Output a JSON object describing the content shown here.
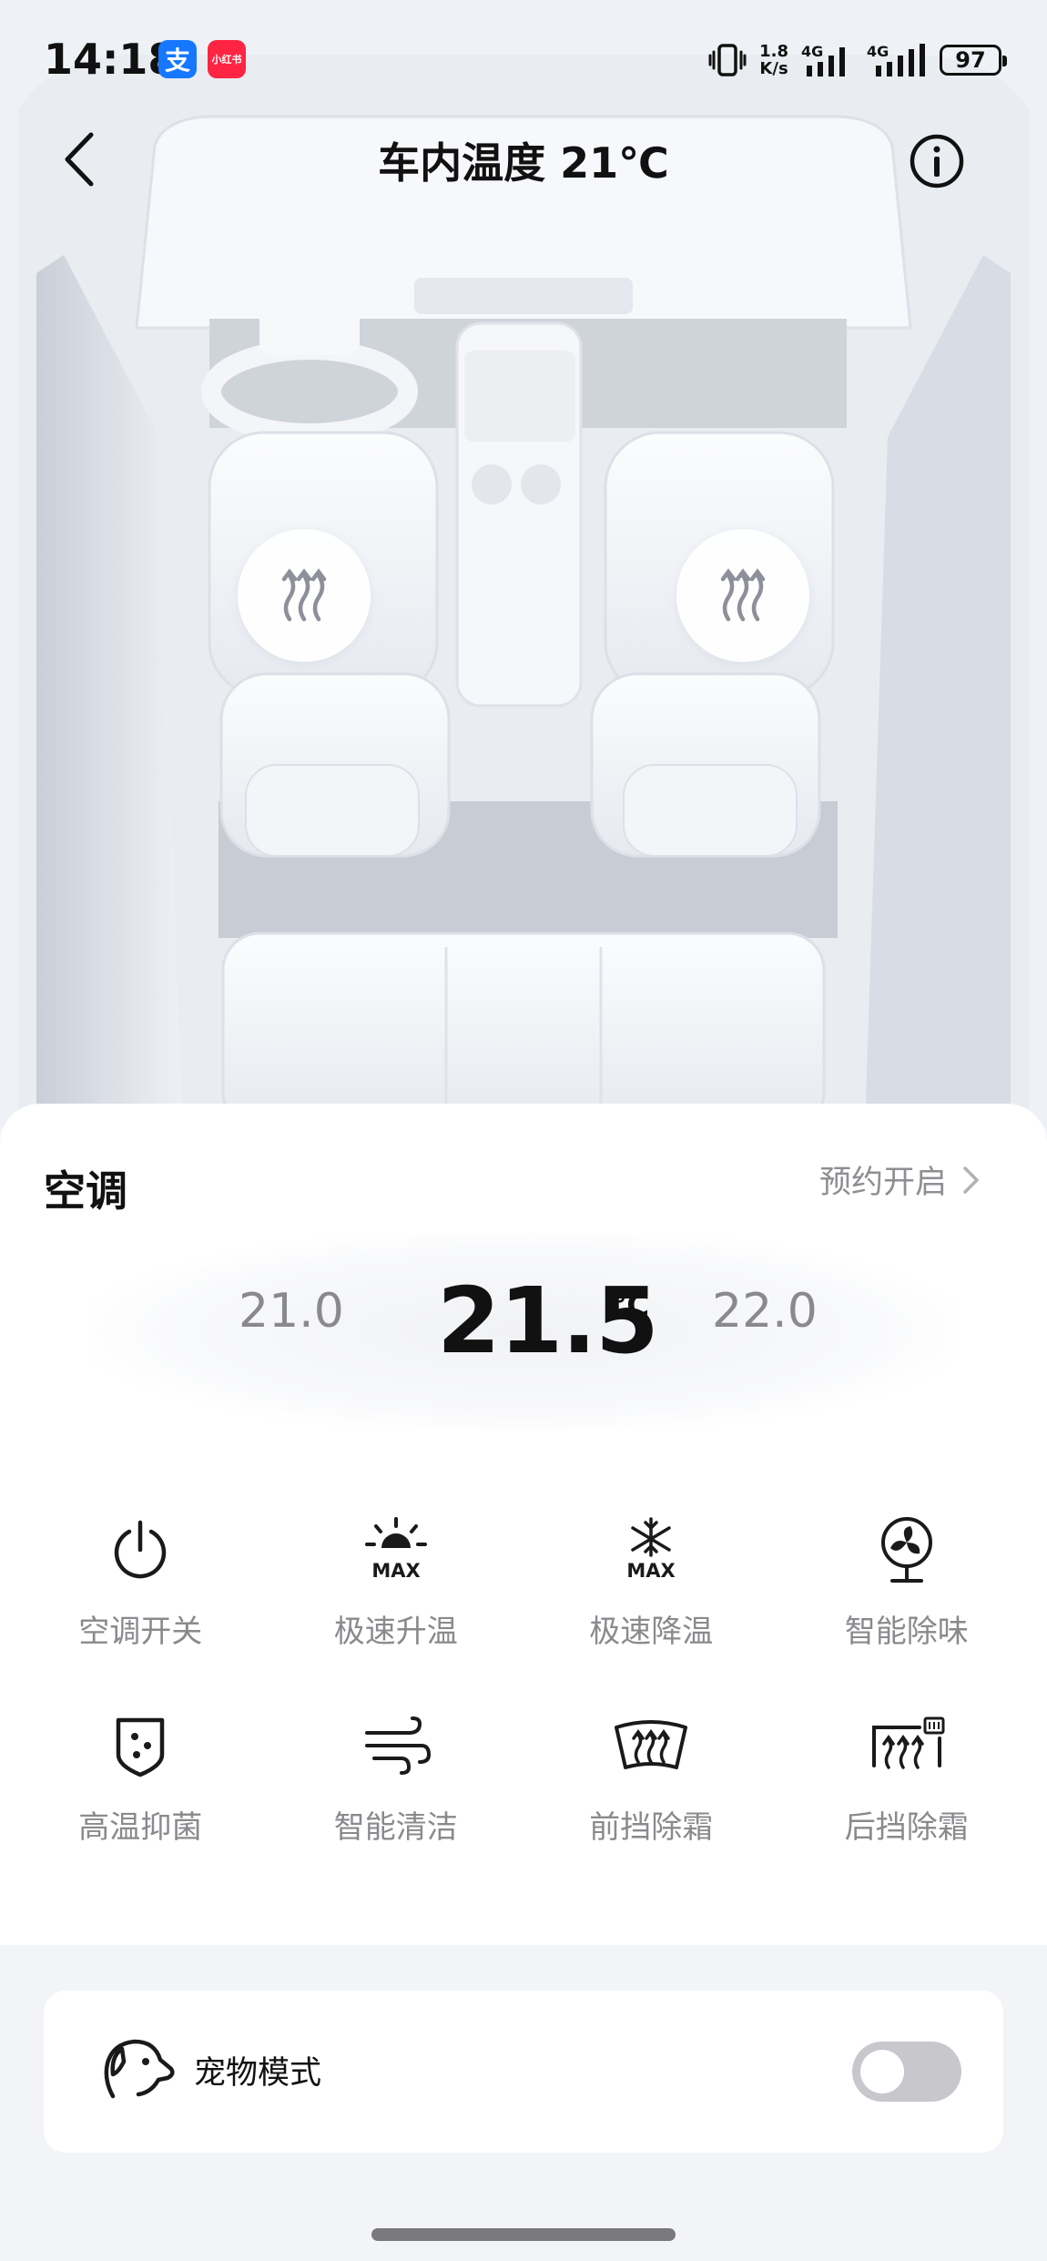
{
  "status_bar": {
    "time": "14:18",
    "apps": [
      {
        "name": "alipay",
        "glyph": "支",
        "color": "#1677ff"
      },
      {
        "name": "xiaohongshu",
        "glyph": "小红书",
        "color": "#ff2442"
      }
    ],
    "net_speed_value": "1.8",
    "net_speed_unit": "K/s",
    "network": [
      "4G",
      "4G"
    ],
    "battery": "97"
  },
  "nav": {
    "title": "车内温度 21℃",
    "back_icon": "chevron-left-icon",
    "info_icon": "info-icon"
  },
  "seat_heaters": [
    {
      "seat": "driver",
      "icon": "seat-heat-icon"
    },
    {
      "seat": "passenger",
      "icon": "seat-heat-icon"
    }
  ],
  "ac": {
    "title": "空调",
    "schedule_label": "预约开启",
    "temp_prev": "21.0",
    "temp_current": "21.5",
    "temp_next": "22.0",
    "unit": "℃",
    "functions": [
      {
        "label": "空调开关",
        "icon": "power-icon"
      },
      {
        "label": "极速升温",
        "icon": "sun-max-icon"
      },
      {
        "label": "极速降温",
        "icon": "snowflake-max-icon"
      },
      {
        "label": "智能除味",
        "icon": "fan-icon"
      },
      {
        "label": "高温抑菌",
        "icon": "shield-dots-icon"
      },
      {
        "label": "智能清洁",
        "icon": "wind-icon"
      },
      {
        "label": "前挡除霜",
        "icon": "front-defrost-icon"
      },
      {
        "label": "后挡除霜",
        "icon": "rear-defrost-icon"
      }
    ]
  },
  "pet_mode": {
    "label": "宠物模式",
    "icon": "dog-icon",
    "enabled": false
  },
  "colors": {
    "accent_text": "#111111",
    "secondary_text": "#8a8a8e",
    "toggle_off": "#c7c7cc",
    "alipay": "#1677ff",
    "xiaohongshu": "#ff2442"
  }
}
